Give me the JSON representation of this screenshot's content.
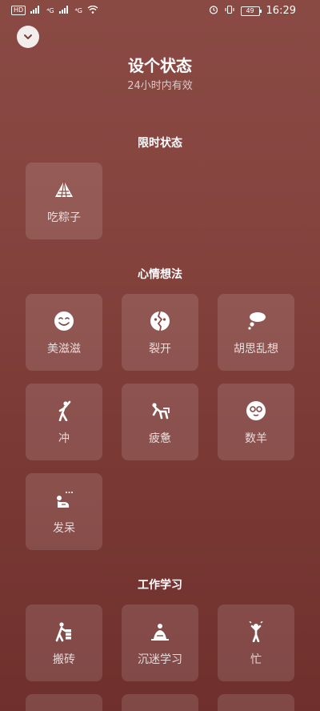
{
  "status_bar": {
    "left": [
      "HD",
      "⁴G",
      "⁴G"
    ],
    "battery": "49",
    "time": "16:29"
  },
  "header": {
    "title": "设个状态",
    "subtitle": "24小时内有效"
  },
  "sections": [
    {
      "title": "限时状态",
      "items": [
        {
          "label": "吃粽子",
          "icon": "zongzi-icon"
        }
      ]
    },
    {
      "title": "心情想法",
      "items": [
        {
          "label": "美滋滋",
          "icon": "smile-icon"
        },
        {
          "label": "裂开",
          "icon": "cracked-face-icon"
        },
        {
          "label": "胡思乱想",
          "icon": "thought-bubble-icon"
        },
        {
          "label": "冲",
          "icon": "rush-person-icon"
        },
        {
          "label": "疲惫",
          "icon": "tired-person-icon"
        },
        {
          "label": "数羊",
          "icon": "sheep-icon"
        },
        {
          "label": "发呆",
          "icon": "daze-person-icon"
        }
      ]
    },
    {
      "title": "工作学习",
      "items": [
        {
          "label": "搬砖",
          "icon": "carry-bricks-icon"
        },
        {
          "label": "沉迷学习",
          "icon": "study-person-icon"
        },
        {
          "label": "忙",
          "icon": "busy-person-icon"
        }
      ]
    }
  ]
}
